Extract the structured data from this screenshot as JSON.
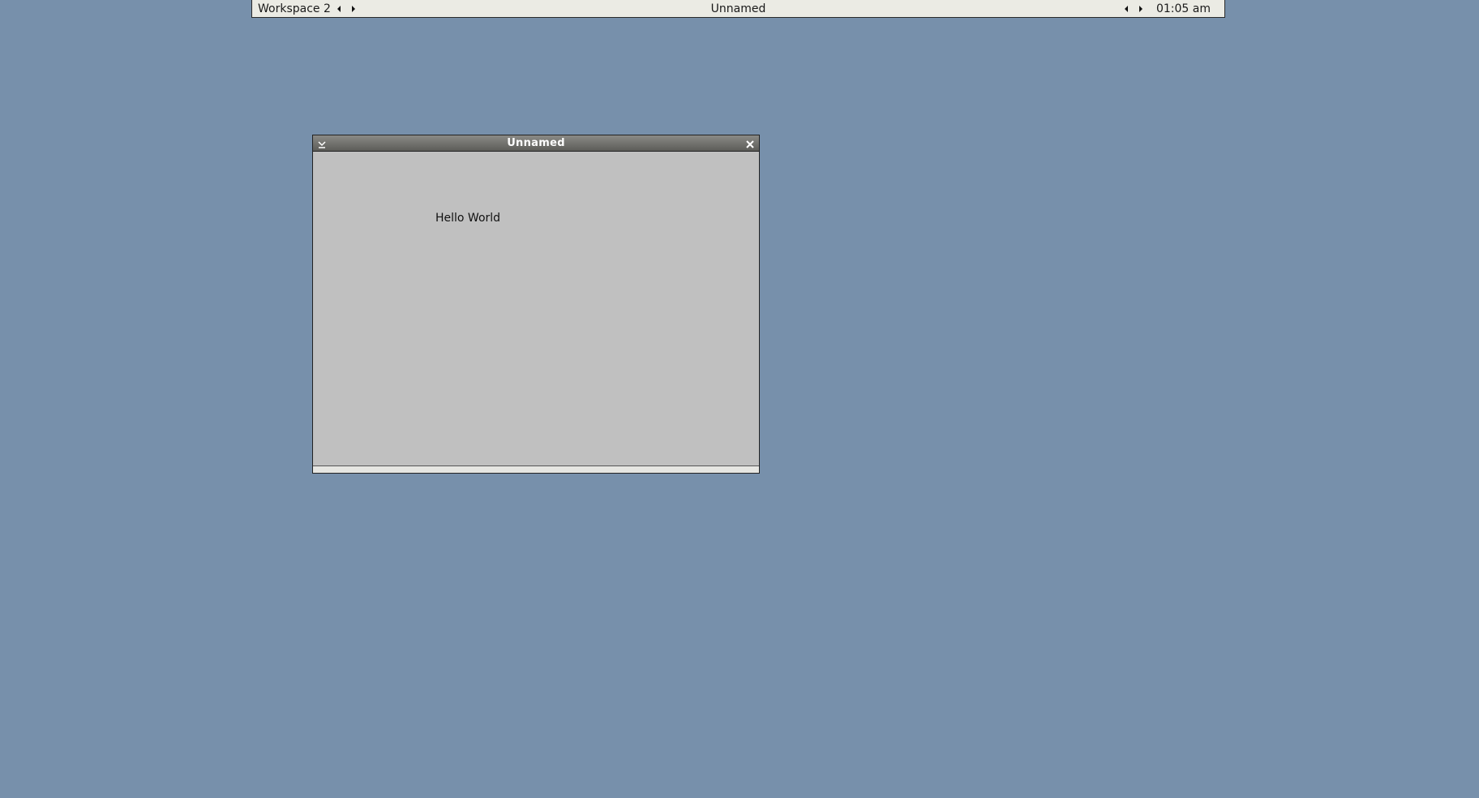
{
  "colors": {
    "desktop_background": "#7790ab",
    "toolbar_background": "#ebebe4",
    "titlebar_background": "#6e6e6a",
    "window_background": "#c0c0c0"
  },
  "toolbar": {
    "workspace_label": "Workspace 2",
    "window_title": "Unnamed",
    "clock": "01:05 am",
    "icons": [
      "triangle-left-icon",
      "triangle-right-icon",
      "triangle-left-icon",
      "triangle-right-icon"
    ]
  },
  "window": {
    "title": "Unnamed",
    "content_text": "Hello World",
    "icons": [
      "iconify-icon",
      "close-icon"
    ]
  }
}
